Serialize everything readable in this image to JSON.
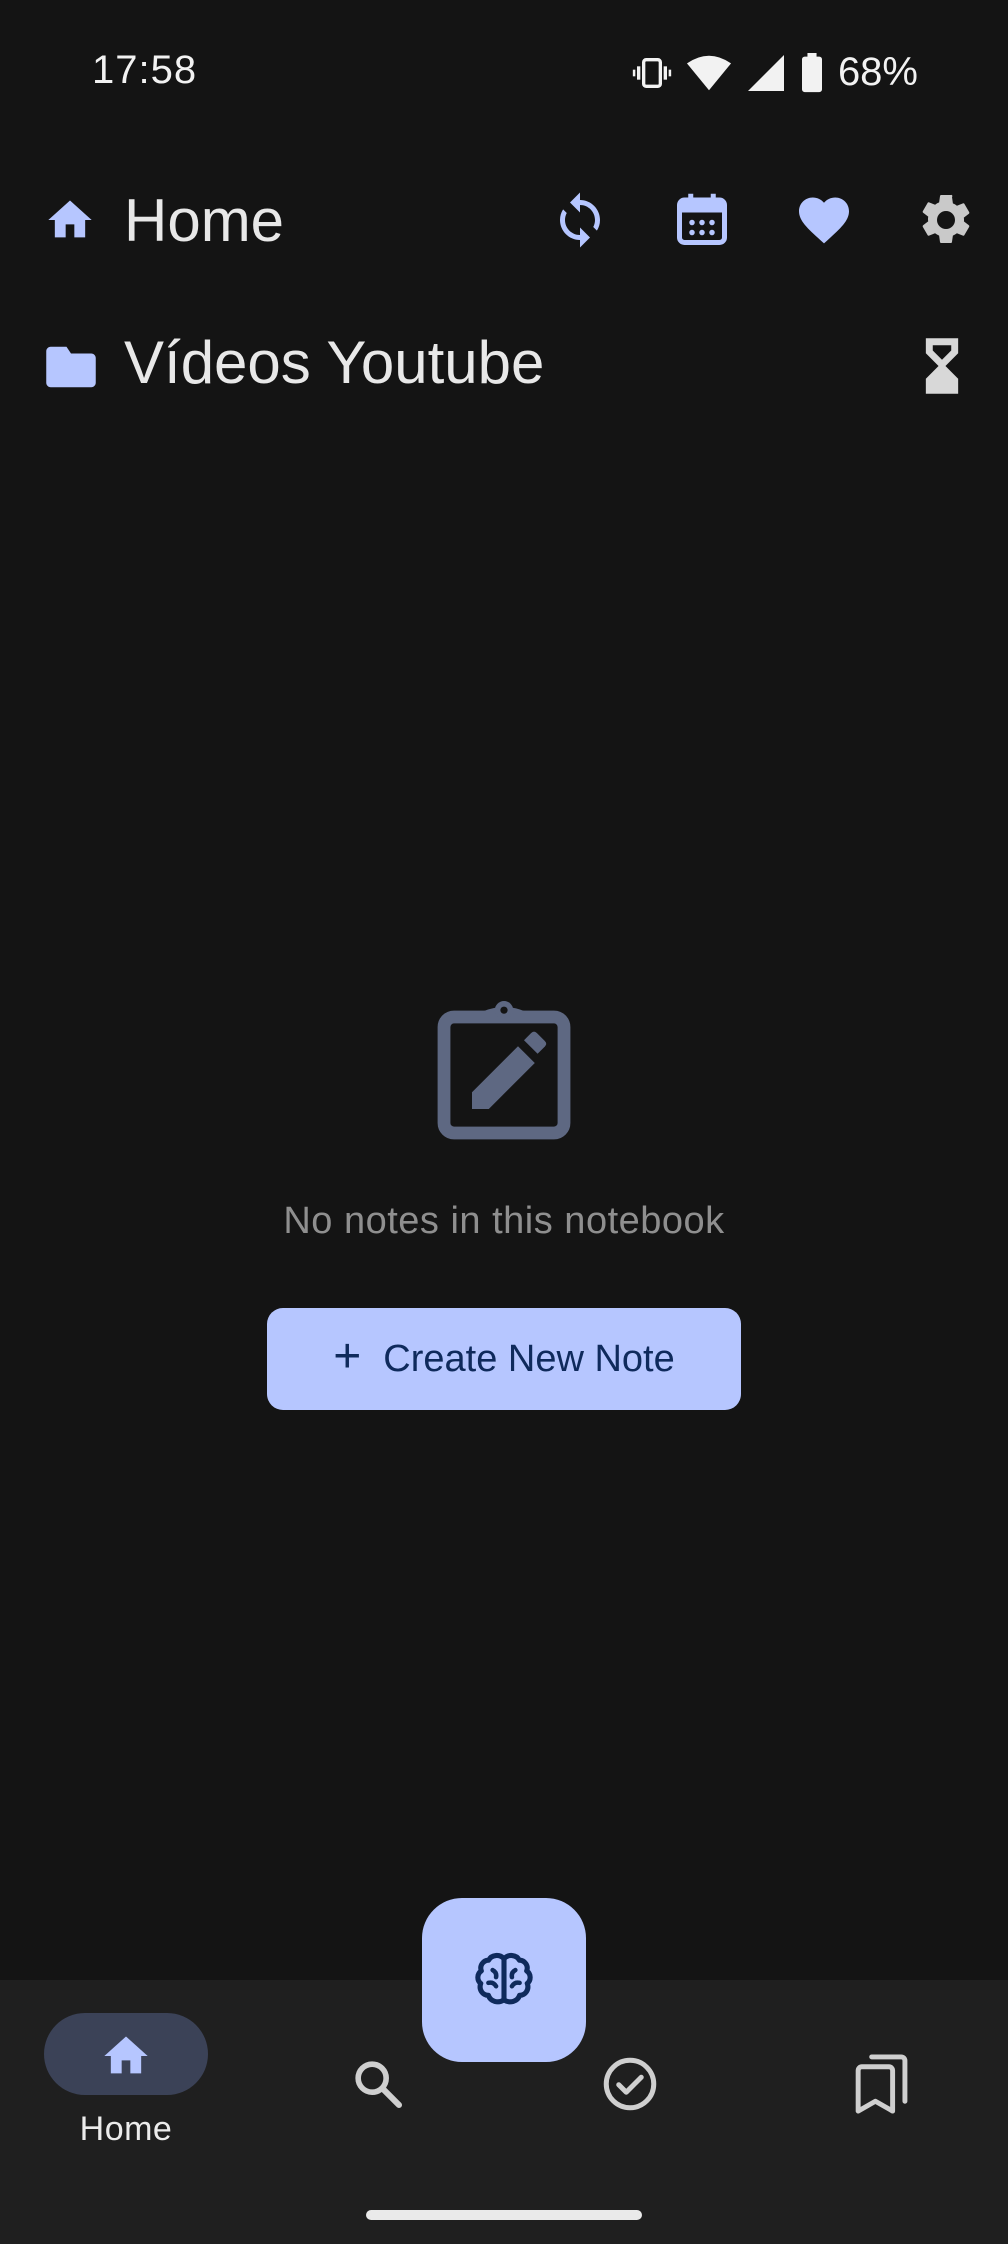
{
  "status_bar": {
    "time": "17:58",
    "battery_percent": "68%"
  },
  "header": {
    "title": "Home",
    "icons": [
      "home-icon",
      "sync-icon",
      "calendar-icon",
      "heart-icon",
      "gear-icon"
    ]
  },
  "notebook": {
    "title": "Vídeos Youtube",
    "icons": [
      "folder-icon",
      "hourglass-icon"
    ]
  },
  "empty_state": {
    "message": "No notes in this notebook",
    "button_label": "Create New Note",
    "button_icon": "+"
  },
  "bottom_nav": {
    "items": [
      {
        "label": "Home",
        "icon": "home-icon",
        "active": true
      },
      {
        "label": "",
        "icon": "search-icon",
        "active": false
      },
      {
        "label": "",
        "icon": "check-circle-icon",
        "active": false
      },
      {
        "label": "",
        "icon": "bookmarks-icon",
        "active": false
      }
    ],
    "fab_icon": "brain-icon"
  },
  "colors": {
    "background": "#141414",
    "accent": "#b6c6ff",
    "nav_background": "#1f1f1f",
    "muted_icon": "#5e6882"
  }
}
